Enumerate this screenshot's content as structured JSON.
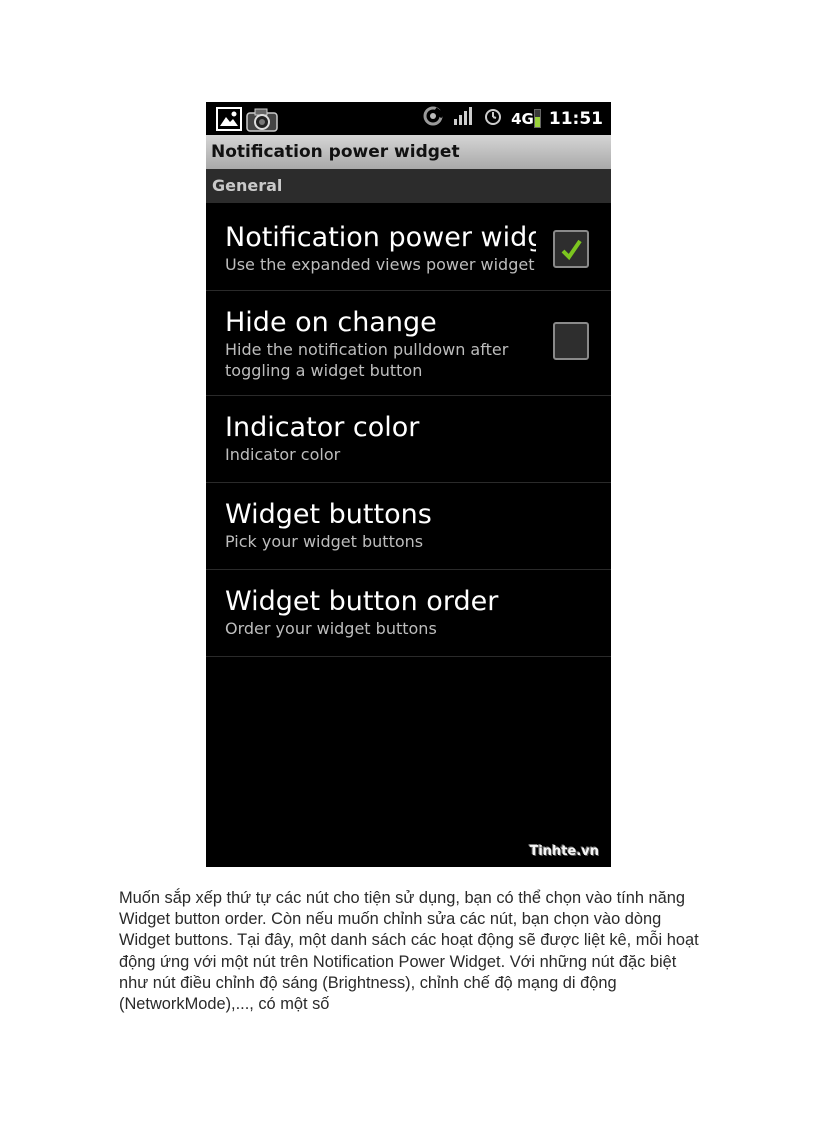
{
  "statusbar": {
    "network": "4G",
    "time": "11:51",
    "icons": [
      "gallery-icon",
      "camera-icon",
      "sync-icon",
      "signal-icon",
      "alarm-icon"
    ]
  },
  "screen": {
    "title": "Notification power widget",
    "category": "General",
    "preferences": [
      {
        "title": "Notification power widge",
        "summary": "Use the expanded views power widget",
        "has_checkbox": true,
        "checked": true
      },
      {
        "title": "Hide on change",
        "summary": "Hide the notification pulldown after toggling a widget button",
        "has_checkbox": true,
        "checked": false
      },
      {
        "title": "Indicator color",
        "summary": "Indicator color"
      },
      {
        "title": "Widget buttons",
        "summary": "Pick your widget buttons"
      },
      {
        "title": "Widget button order",
        "summary": "Order your widget buttons"
      }
    ],
    "watermark": "Tinhte.vn"
  },
  "colors": {
    "check_green": "#7cc61f",
    "title_bar": "#bdbdbd",
    "category_bg": "#2c2c2c"
  },
  "paragraph": "Muốn sắp xếp thứ tự các nút cho tiện sử dụng, bạn có thể chọn vào tính năng Widget button order. Còn nếu muốn chỉnh sửa các nút, bạn chọn vào dòng Widget buttons. Tại đây, một danh sách các hoạt động sẽ được liệt kê, mỗi hoạt động ứng với một nút trên Notification Power Widget. Với những nút đặc biệt như nút điều chỉnh độ sáng (Brightness), chỉnh chế độ mạng di động (NetworkMode),..., có một số"
}
